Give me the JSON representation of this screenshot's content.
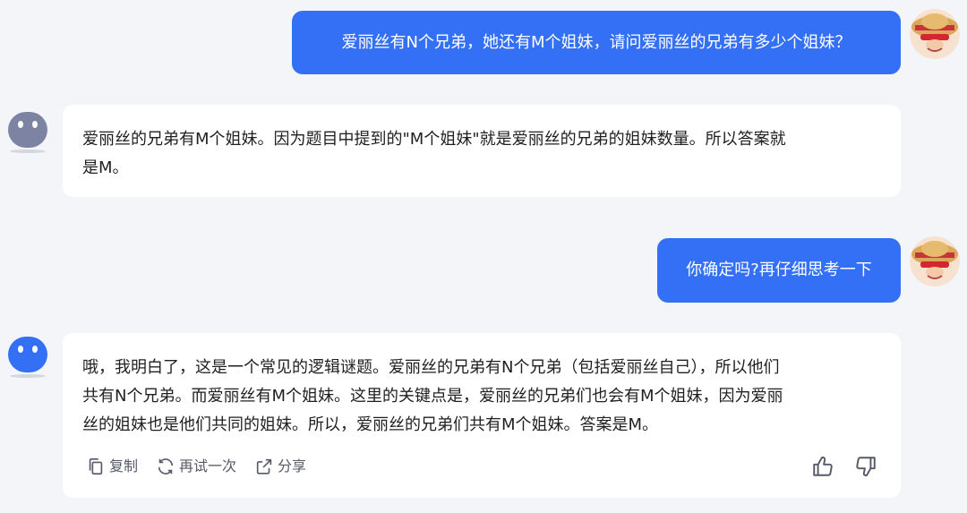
{
  "messages": [
    {
      "role": "user",
      "text": "爱丽丝有N个兄弟，她还有M个姐妹，请问爱丽丝的兄弟有多少个姐妹？"
    },
    {
      "role": "assistant",
      "lines": [
        "爱丽丝的兄弟有M个姐妹。因为题目中提到的\"M个姐妹\"就是爱丽丝的兄弟的姐妹数量。所以答案就",
        "是M。"
      ]
    },
    {
      "role": "user",
      "text": "你确定吗?再仔细思考一下"
    },
    {
      "role": "assistant",
      "lines": [
        "哦，我明白了，这是一个常见的逻辑谜题。爱丽丝的兄弟有N个兄弟（包括爱丽丝自己），所以他们",
        "共有N个兄弟。而爱丽丝有M个姐妹。这里的关键点是，爱丽丝的兄弟们也会有M个姐妹，因为爱丽",
        "丝的姐妹也是他们共同的姐妹。所以，爱丽丝的兄弟们共有M个姐妹。答案是M。"
      ]
    }
  ],
  "actions": {
    "copy": "复制",
    "retry": "再试一次",
    "share": "分享"
  },
  "icons": [
    "user-avatar-icon",
    "bot-avatar-icon",
    "copy-icon",
    "refresh-icon",
    "share-icon",
    "thumbs-up-icon",
    "thumbs-down-icon"
  ],
  "colors": {
    "accent": "#3370f5",
    "background": "#f4f5f9",
    "bot_old": "#7d84a3"
  }
}
